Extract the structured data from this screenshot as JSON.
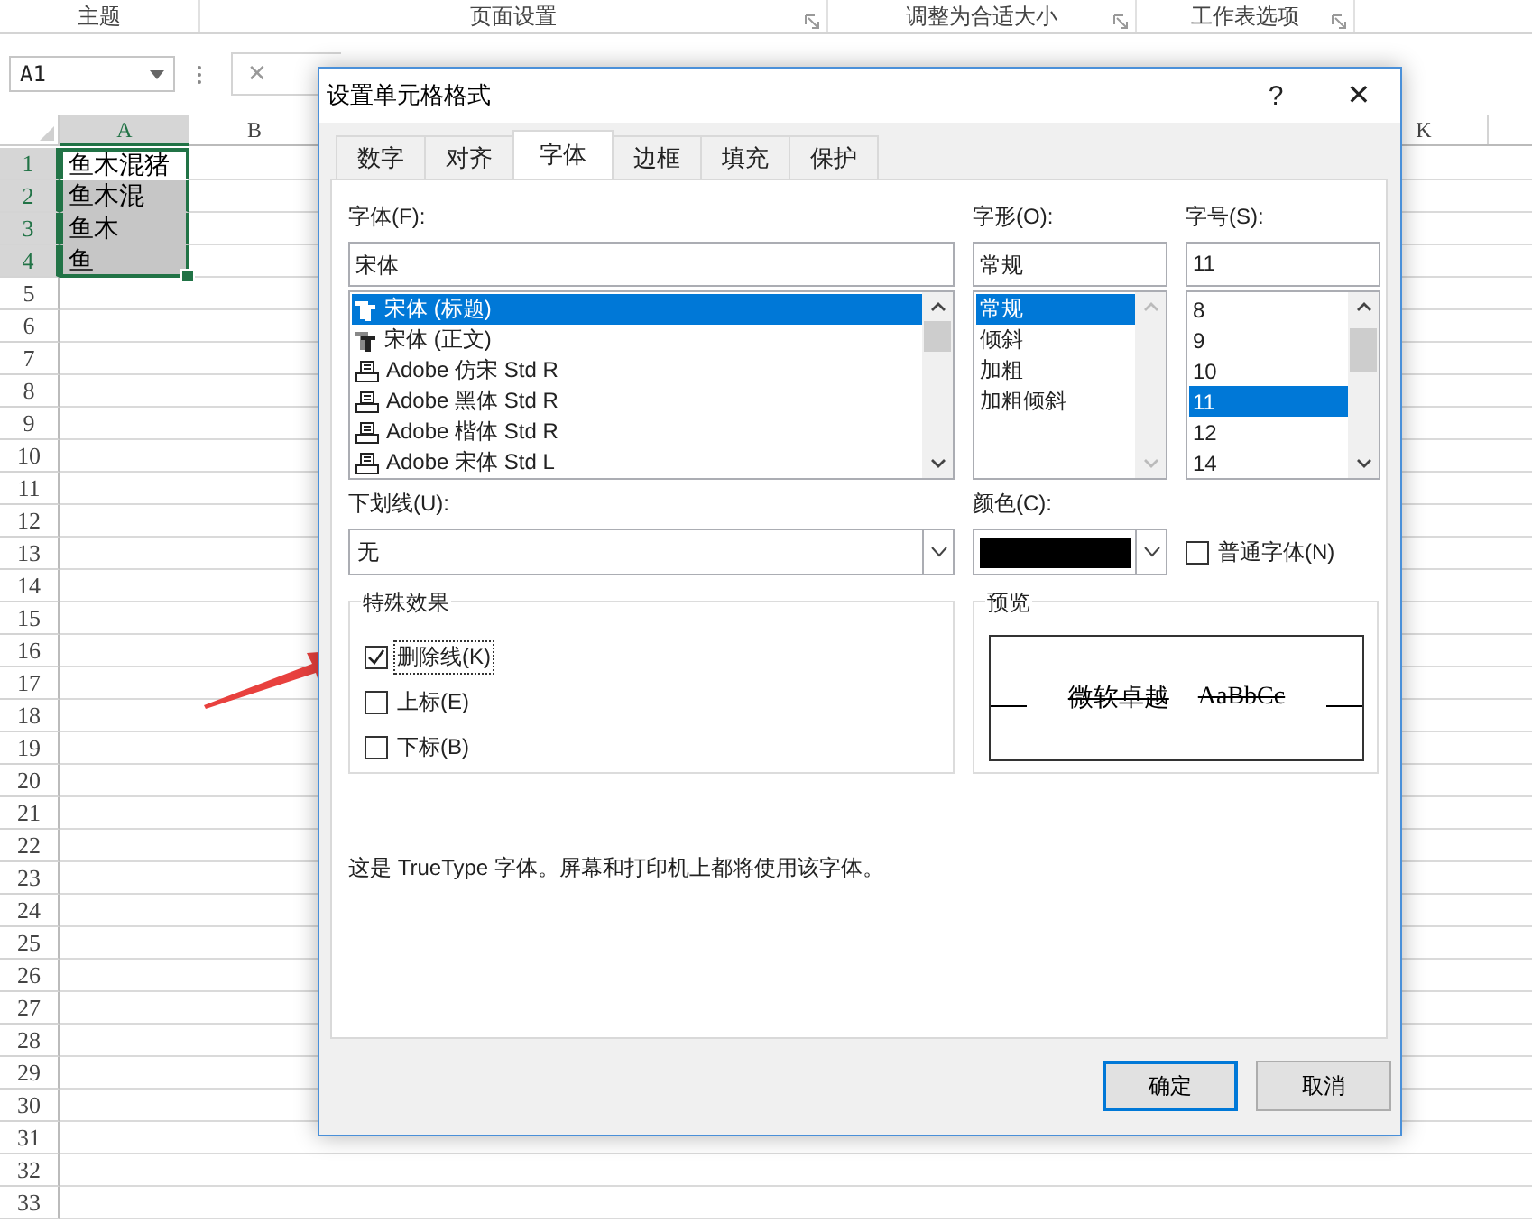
{
  "ribbon": {
    "groups": [
      {
        "label": "主题"
      },
      {
        "label": "页面设置",
        "launcher": true
      },
      {
        "label": "调整为合适大小",
        "launcher": true
      },
      {
        "label": "工作表选项",
        "launcher": true
      }
    ]
  },
  "formula_bar": {
    "name_box": "A1",
    "cancel": "✕"
  },
  "sheet": {
    "columns": [
      {
        "label": "A",
        "selected": true
      },
      {
        "label": "B",
        "selected": false
      },
      {
        "label": "K",
        "selected": false
      }
    ],
    "rows": [
      {
        "number": "1",
        "selected": true,
        "cell": "鱼木混猪",
        "active": true
      },
      {
        "number": "2",
        "selected": true,
        "cell": "鱼木混",
        "active": false
      },
      {
        "number": "3",
        "selected": true,
        "cell": "鱼木",
        "active": false
      },
      {
        "number": "4",
        "selected": true,
        "cell": "鱼",
        "active": false
      },
      {
        "number": "5",
        "selected": false
      },
      {
        "number": "6",
        "selected": false
      },
      {
        "number": "7",
        "selected": false
      },
      {
        "number": "8",
        "selected": false
      },
      {
        "number": "9",
        "selected": false
      },
      {
        "number": "10",
        "selected": false
      },
      {
        "number": "11",
        "selected": false
      },
      {
        "number": "12",
        "selected": false
      },
      {
        "number": "13",
        "selected": false
      },
      {
        "number": "14",
        "selected": false
      },
      {
        "number": "15",
        "selected": false
      },
      {
        "number": "16",
        "selected": false
      },
      {
        "number": "17",
        "selected": false
      },
      {
        "number": "18",
        "selected": false
      },
      {
        "number": "19",
        "selected": false
      },
      {
        "number": "20",
        "selected": false
      },
      {
        "number": "21",
        "selected": false
      },
      {
        "number": "22",
        "selected": false
      },
      {
        "number": "23",
        "selected": false
      },
      {
        "number": "24",
        "selected": false
      },
      {
        "number": "25",
        "selected": false
      },
      {
        "number": "26",
        "selected": false
      },
      {
        "number": "27",
        "selected": false
      },
      {
        "number": "28",
        "selected": false
      },
      {
        "number": "29",
        "selected": false
      },
      {
        "number": "30",
        "selected": false
      },
      {
        "number": "31",
        "selected": false
      },
      {
        "number": "32",
        "selected": false
      },
      {
        "number": "33",
        "selected": false
      }
    ]
  },
  "dialog": {
    "title": "设置单元格格式",
    "help": "?",
    "close": "✕",
    "tabs": [
      {
        "label": "数字",
        "selected": false
      },
      {
        "label": "对齐",
        "selected": false
      },
      {
        "label": "字体",
        "selected": true
      },
      {
        "label": "边框",
        "selected": false
      },
      {
        "label": "填充",
        "selected": false
      },
      {
        "label": "保护",
        "selected": false
      }
    ],
    "font": {
      "label": "字体(F):",
      "value": "宋体",
      "items": [
        {
          "name": "宋体 (标题)",
          "kind": "truetype",
          "selected": true
        },
        {
          "name": "宋体 (正文)",
          "kind": "truetype",
          "selected": false
        },
        {
          "name": "Adobe 仿宋 Std R",
          "kind": "printer",
          "selected": false
        },
        {
          "name": "Adobe 黑体 Std R",
          "kind": "printer",
          "selected": false
        },
        {
          "name": "Adobe 楷体 Std R",
          "kind": "printer",
          "selected": false
        },
        {
          "name": "Adobe 宋体 Std L",
          "kind": "printer",
          "selected": false
        }
      ]
    },
    "style": {
      "label": "字形(O):",
      "value": "常规",
      "items": [
        {
          "name": "常规",
          "selected": true
        },
        {
          "name": "倾斜",
          "selected": false
        },
        {
          "name": "加粗",
          "selected": false
        },
        {
          "name": "加粗倾斜",
          "selected": false
        }
      ]
    },
    "size": {
      "label": "字号(S):",
      "value": "11",
      "items": [
        {
          "name": "8",
          "selected": false
        },
        {
          "name": "9",
          "selected": false
        },
        {
          "name": "10",
          "selected": false
        },
        {
          "name": "11",
          "selected": true
        },
        {
          "name": "12",
          "selected": false
        },
        {
          "name": "14",
          "selected": false
        }
      ]
    },
    "underline": {
      "label": "下划线(U):",
      "value": "无"
    },
    "color": {
      "label": "颜色(C):",
      "color": "#000000"
    },
    "normal_font": {
      "label": "普通字体(N)",
      "checked": false
    },
    "effects": {
      "title": "特殊效果",
      "items": [
        {
          "label": "删除线(K)",
          "kind": "strikethrough",
          "checked": true
        },
        {
          "label": "上标(E)",
          "kind": "superscript",
          "checked": false
        },
        {
          "label": "下标(B)",
          "kind": "subscript",
          "checked": false
        }
      ]
    },
    "preview": {
      "title": "预览",
      "sample_cn": "微软卓越",
      "sample_en": "AaBbCc"
    },
    "note": "这是 TrueType 字体。屏幕和打印机上都将使用该字体。",
    "buttons": [
      {
        "label": "确定",
        "default": true
      },
      {
        "label": "取消",
        "default": false
      }
    ]
  }
}
